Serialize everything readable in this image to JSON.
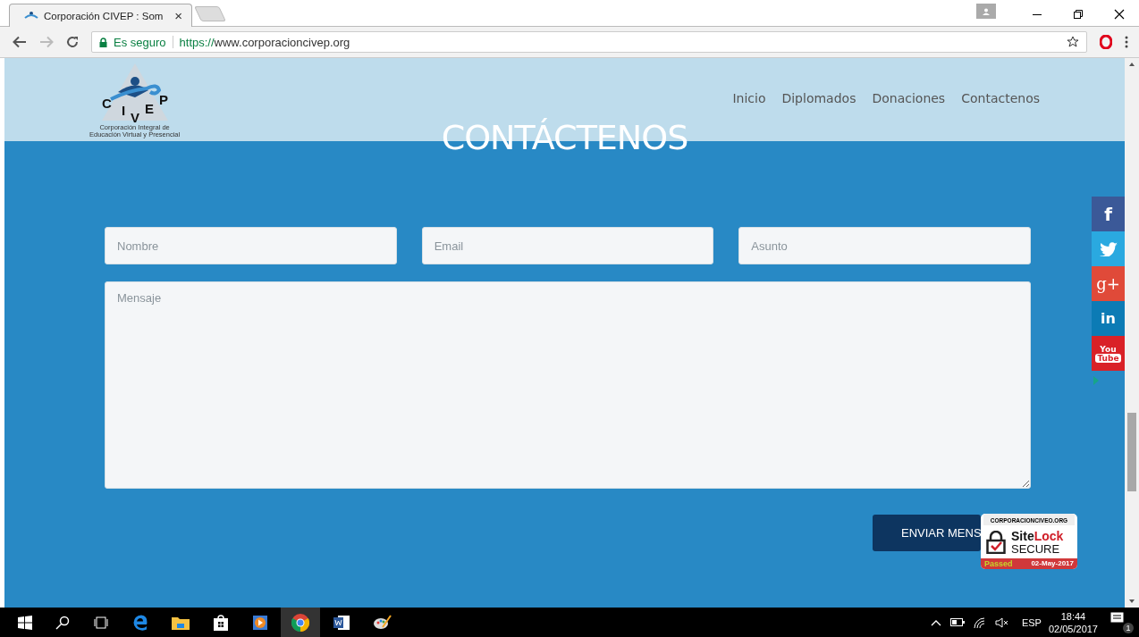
{
  "browser": {
    "tab_title": "Corporación CIVEP : Som",
    "tab_close": "×",
    "secure_label": "Es seguro",
    "url_scheme": "https://",
    "url_rest": "www.corporacioncivep.org"
  },
  "logo": {
    "letters": [
      "C",
      "I",
      "V",
      "E",
      "P"
    ],
    "tagline": [
      "Corporación Integral de",
      "Educación Virtual y Presencial"
    ]
  },
  "nav": [
    {
      "label": "Inicio"
    },
    {
      "label": "Diplomados"
    },
    {
      "label": "Donaciones"
    },
    {
      "label": "Contactenos"
    }
  ],
  "title": "CONTÁCTENOS",
  "form": {
    "fields": [
      {
        "placeholder": "Nombre"
      },
      {
        "placeholder": "Email"
      },
      {
        "placeholder": "Asunto"
      }
    ],
    "message_placeholder": "Mensaje",
    "submit": "ENVIAR MENS"
  },
  "social": [
    {
      "kind": "facebook",
      "label": "f",
      "color": "#3b5998"
    },
    {
      "kind": "twitter",
      "color": "#2aa9e0"
    },
    {
      "kind": "googleplus",
      "label": "g+",
      "color": "#e04a39"
    },
    {
      "kind": "linkedin",
      "label": "in",
      "color": "#0c7bb5"
    },
    {
      "kind": "youtube",
      "label": "You",
      "label2": "Tube",
      "color": "#d92127"
    }
  ],
  "badge": {
    "domain": "CORPORACIONCIVEO.ORG",
    "brand_a": "Site",
    "brand_b": "Lock",
    "secure": "SECURE",
    "status": "Passed",
    "date": "02-May-2017"
  },
  "taskbar": {
    "language": "ESP",
    "time": "18:44",
    "date": "02/05/2017",
    "notifications": "1"
  }
}
